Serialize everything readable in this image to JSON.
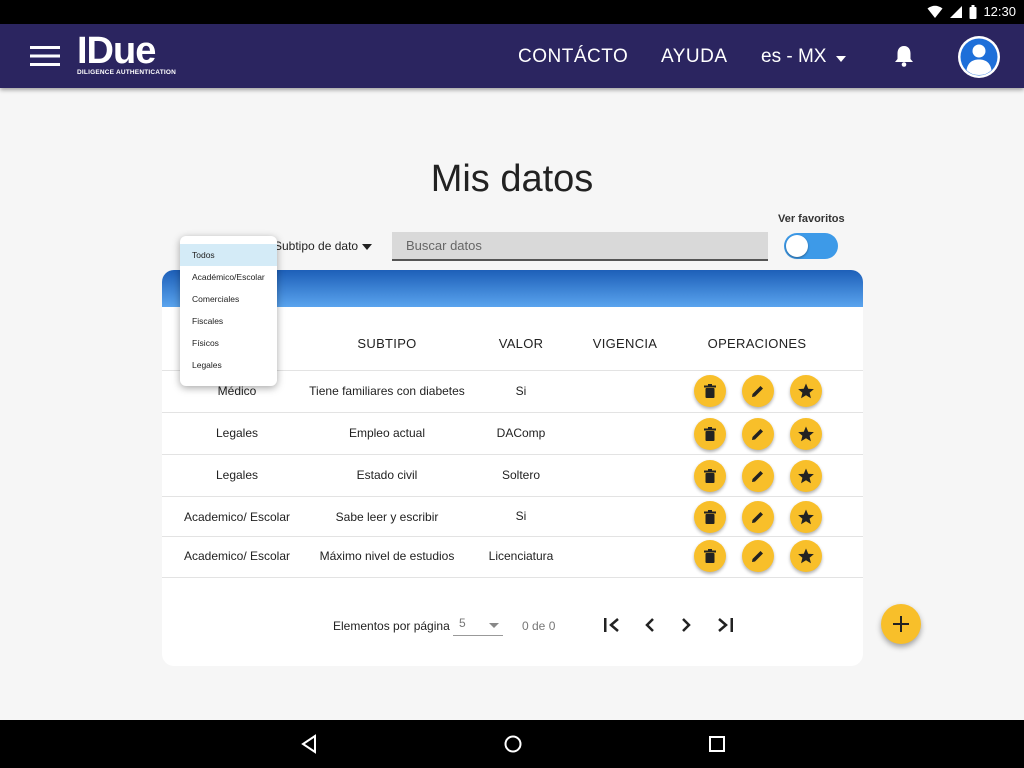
{
  "statusbar": {
    "time": "12:30"
  },
  "appbar": {
    "logo_text": "IDue",
    "logo_tagline": "DILIGENCE AUTHENTICATION",
    "nav_contact": "CONTÁCTO",
    "nav_help": "AYUDA",
    "language": "es - MX",
    "background_color": "#2b2560"
  },
  "page": {
    "title": "Mis datos"
  },
  "filters": {
    "favorites_label": "Ver favoritos",
    "favorites_on": true,
    "subtipo_label": "Subtipo de dato",
    "search_placeholder": "Buscar datos"
  },
  "dropdown": {
    "items": [
      "Todos",
      "Académico/Escolar",
      "Comerciales",
      "Fiscales",
      "Físicos",
      "Legales"
    ],
    "selected": "Todos"
  },
  "table": {
    "columns": [
      "SUBTIPO",
      "VALOR",
      "VIGENCIA",
      "OPERACIONES"
    ],
    "rows": [
      {
        "tipo": "Médico",
        "subtipo": "Tiene familiares con diabetes",
        "valor": "Si",
        "vigencia": ""
      },
      {
        "tipo": "Legales",
        "subtipo": "Empleo actual",
        "valor": "DAComp",
        "vigencia": ""
      },
      {
        "tipo": "Legales",
        "subtipo": "Estado civil",
        "valor": "Soltero",
        "vigencia": ""
      },
      {
        "tipo": "Academico/ Escolar",
        "subtipo": "Sabe leer y escribir",
        "valor": "Si",
        "vigencia": ""
      },
      {
        "tipo": "Academico/ Escolar",
        "subtipo": "Máximo nivel de estudios",
        "valor": "Licenciatura",
        "vigencia": ""
      }
    ],
    "operations": [
      "delete-icon",
      "edit-icon",
      "star-icon"
    ]
  },
  "pagination": {
    "label": "Elementos por página",
    "page_size": "5",
    "range": "0 de 0"
  },
  "colors": {
    "accent": "#f8bf2a",
    "toggle": "#3d9ae8",
    "header_gradient_top": "#1d5fb8",
    "header_gradient_bottom": "#5aa4ee"
  }
}
